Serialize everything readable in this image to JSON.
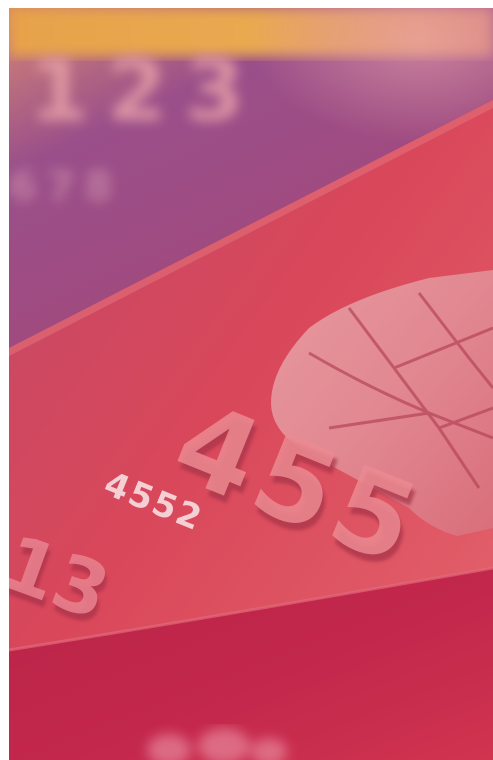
{
  "photo": {
    "subject": "credit-card-closeup",
    "colors": {
      "top_amber": "#e7a24a",
      "upper_purple": "#9a4f8a",
      "card_red": "#d9475a",
      "lower_crimson": "#c4284c",
      "chip_light": "#e9a0a6"
    },
    "printed_digits": "4552",
    "embossed_digits_large": "455",
    "embossed_digits_left": "13",
    "back_card_digits": "123",
    "back_card_small_digits": "678"
  }
}
